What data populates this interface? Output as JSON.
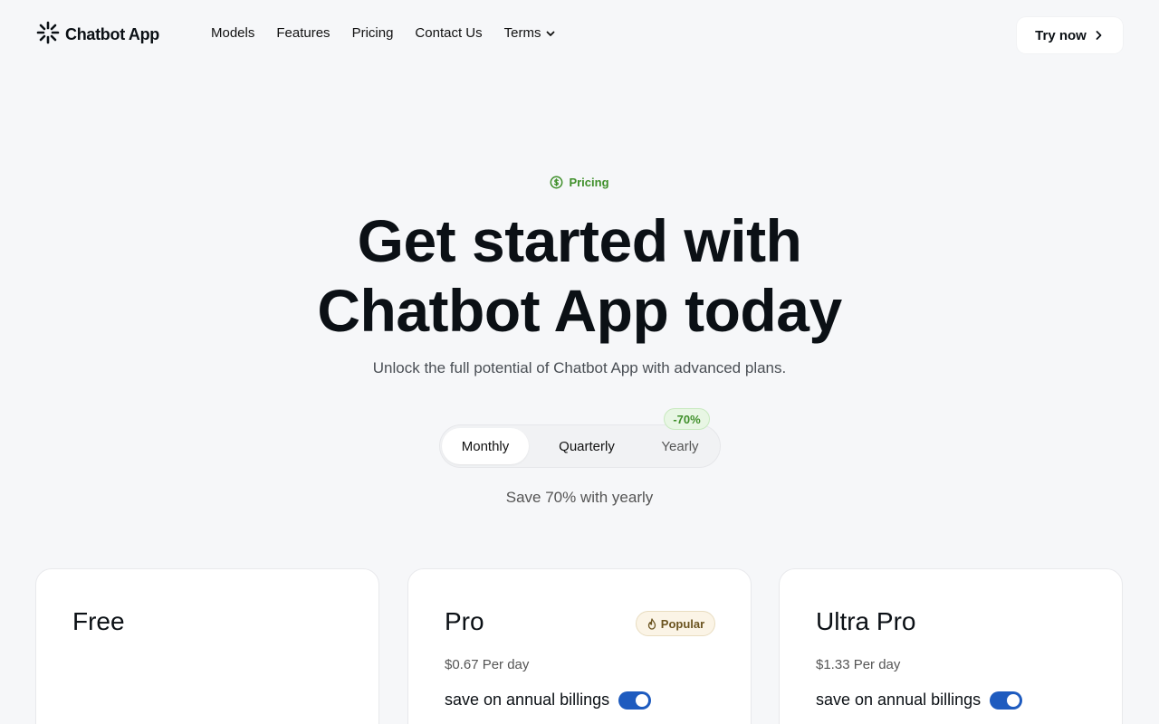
{
  "nav": {
    "logo_text": "Chatbot App",
    "links": [
      "Models",
      "Features",
      "Pricing",
      "Contact Us"
    ],
    "terms_label": "Terms",
    "cta_label": "Try now"
  },
  "hero": {
    "eyebrow": "Pricing",
    "title_line1": "Get started with",
    "title_line2": "Chatbot App today",
    "subtitle": "Unlock the full potential of Chatbot App with advanced plans."
  },
  "billing": {
    "options": [
      "Monthly",
      "Quarterly",
      "Yearly"
    ],
    "selected": "Monthly",
    "discount_badge": "-70%",
    "save_note": "Save 70% with yearly"
  },
  "plans": [
    {
      "name": "Free"
    },
    {
      "name": "Pro",
      "badge": "Popular",
      "per_day": "$0.67 Per day",
      "annual_label": "save on annual billings",
      "annual_on": true
    },
    {
      "name": "Ultra Pro",
      "per_day": "$1.33 Per day",
      "annual_label": "save on annual billings",
      "annual_on": true
    }
  ],
  "colors": {
    "background": "#f6f7f9",
    "accent_green": "#3f8f2a",
    "toggle_blue": "#1e5bbf",
    "text": "#0b1015"
  },
  "icons": {
    "logo": "sparkle-logo-icon",
    "terms": "chevron-down-icon",
    "cta": "chevron-right-icon",
    "eyebrow": "dollar-circle-icon",
    "popular": "flame-icon"
  }
}
